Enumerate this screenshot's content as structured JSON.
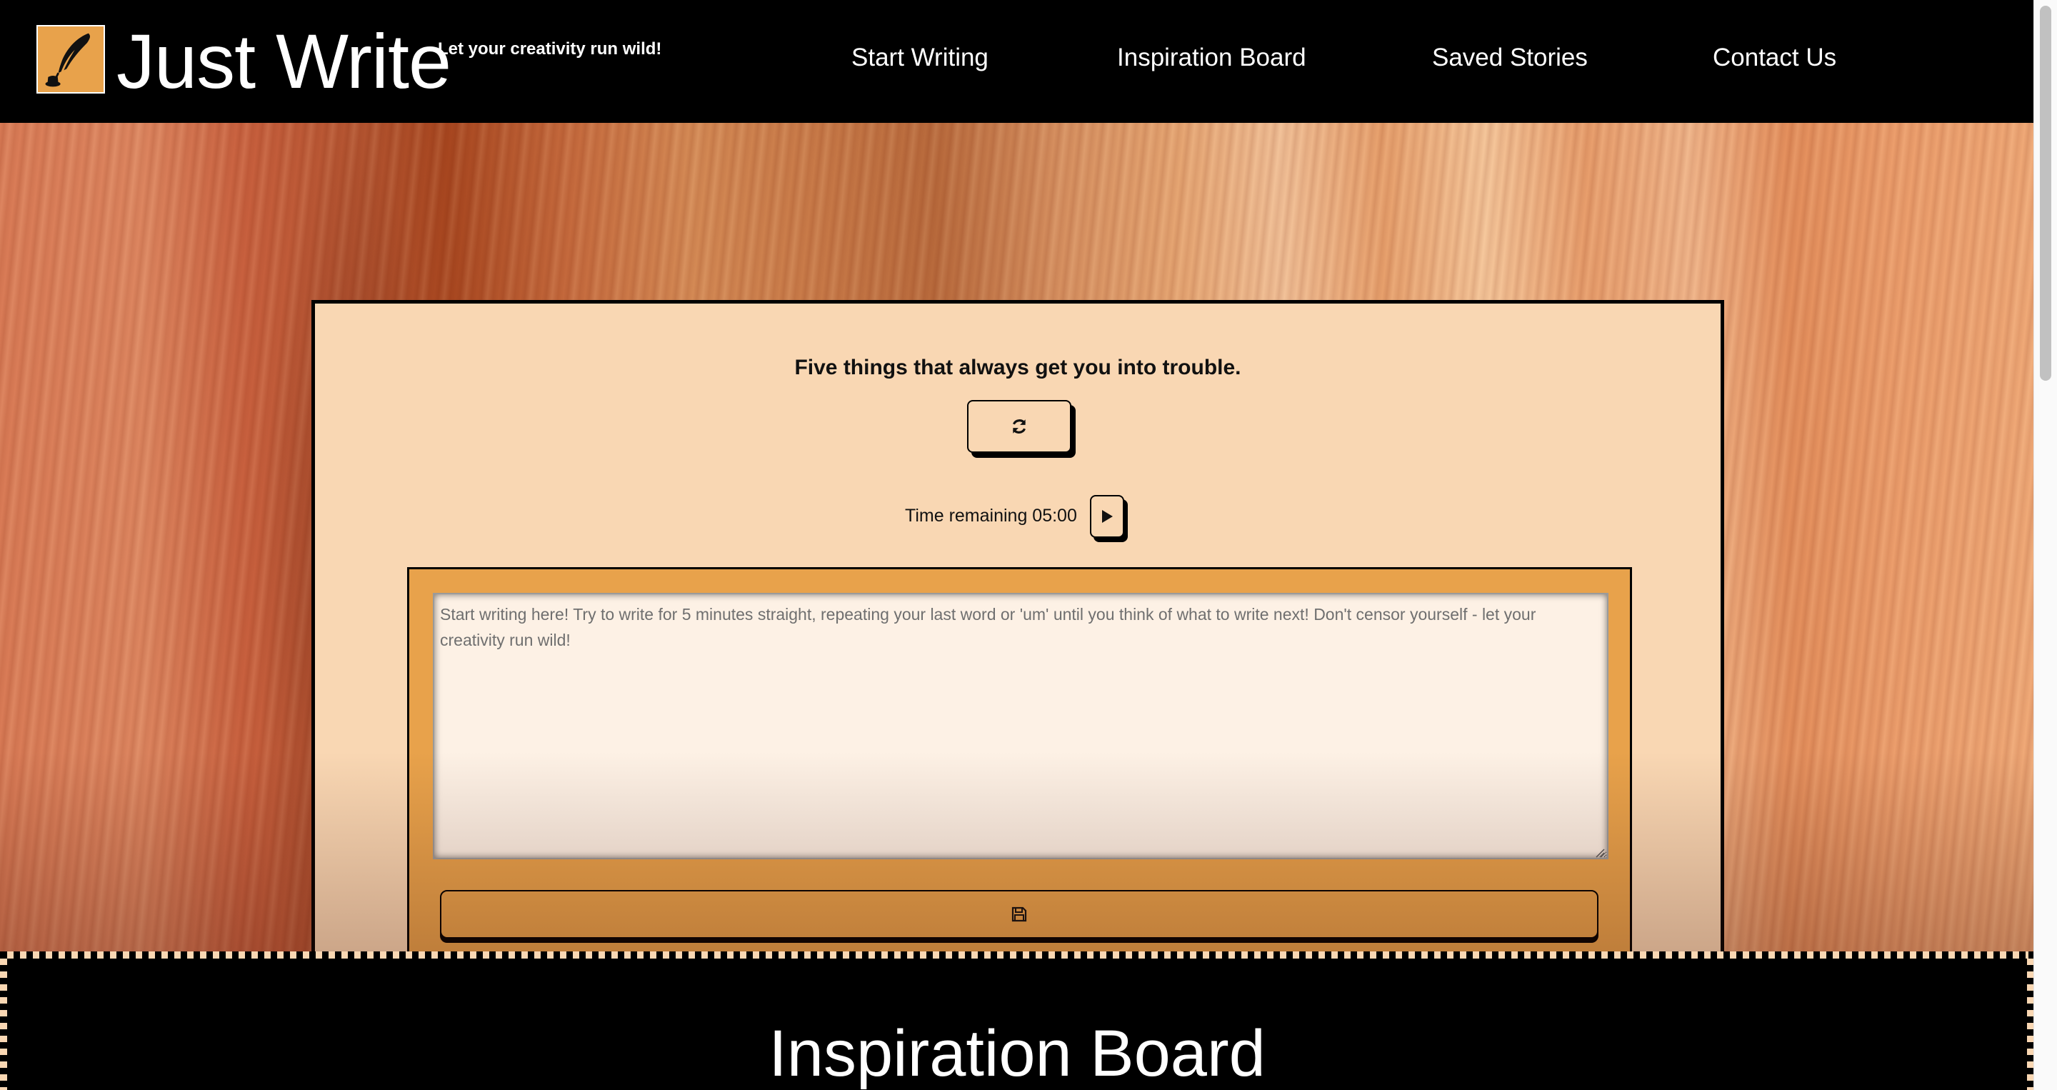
{
  "header": {
    "brand_title": "Just Write",
    "tagline": "Let your creativity run wild!",
    "logo_icon": "quill-inkwell-icon",
    "nav": [
      {
        "label": "Start Writing"
      },
      {
        "label": "Inspiration Board"
      },
      {
        "label": "Saved Stories"
      },
      {
        "label": "Contact Us"
      }
    ]
  },
  "writer": {
    "prompt": "Five things that always get you into trouble.",
    "refresh_icon": "refresh-icon",
    "timer_label": "Time remaining 05:00",
    "play_icon": "play-icon",
    "editor_placeholder": "Start writing here! Try to write for 5 minutes straight, repeating your last word or 'um' until you think of what to write next! Don't censor yourself - let your creativity run wild!",
    "save_icon": "floppy-disk-icon"
  },
  "inspiration": {
    "title": "Inspiration Board"
  },
  "colors": {
    "header_bg": "#000000",
    "card_bg": "#f9d7b3",
    "accent_orange": "#e8a24b",
    "editor_bg": "#fdf1e5"
  }
}
